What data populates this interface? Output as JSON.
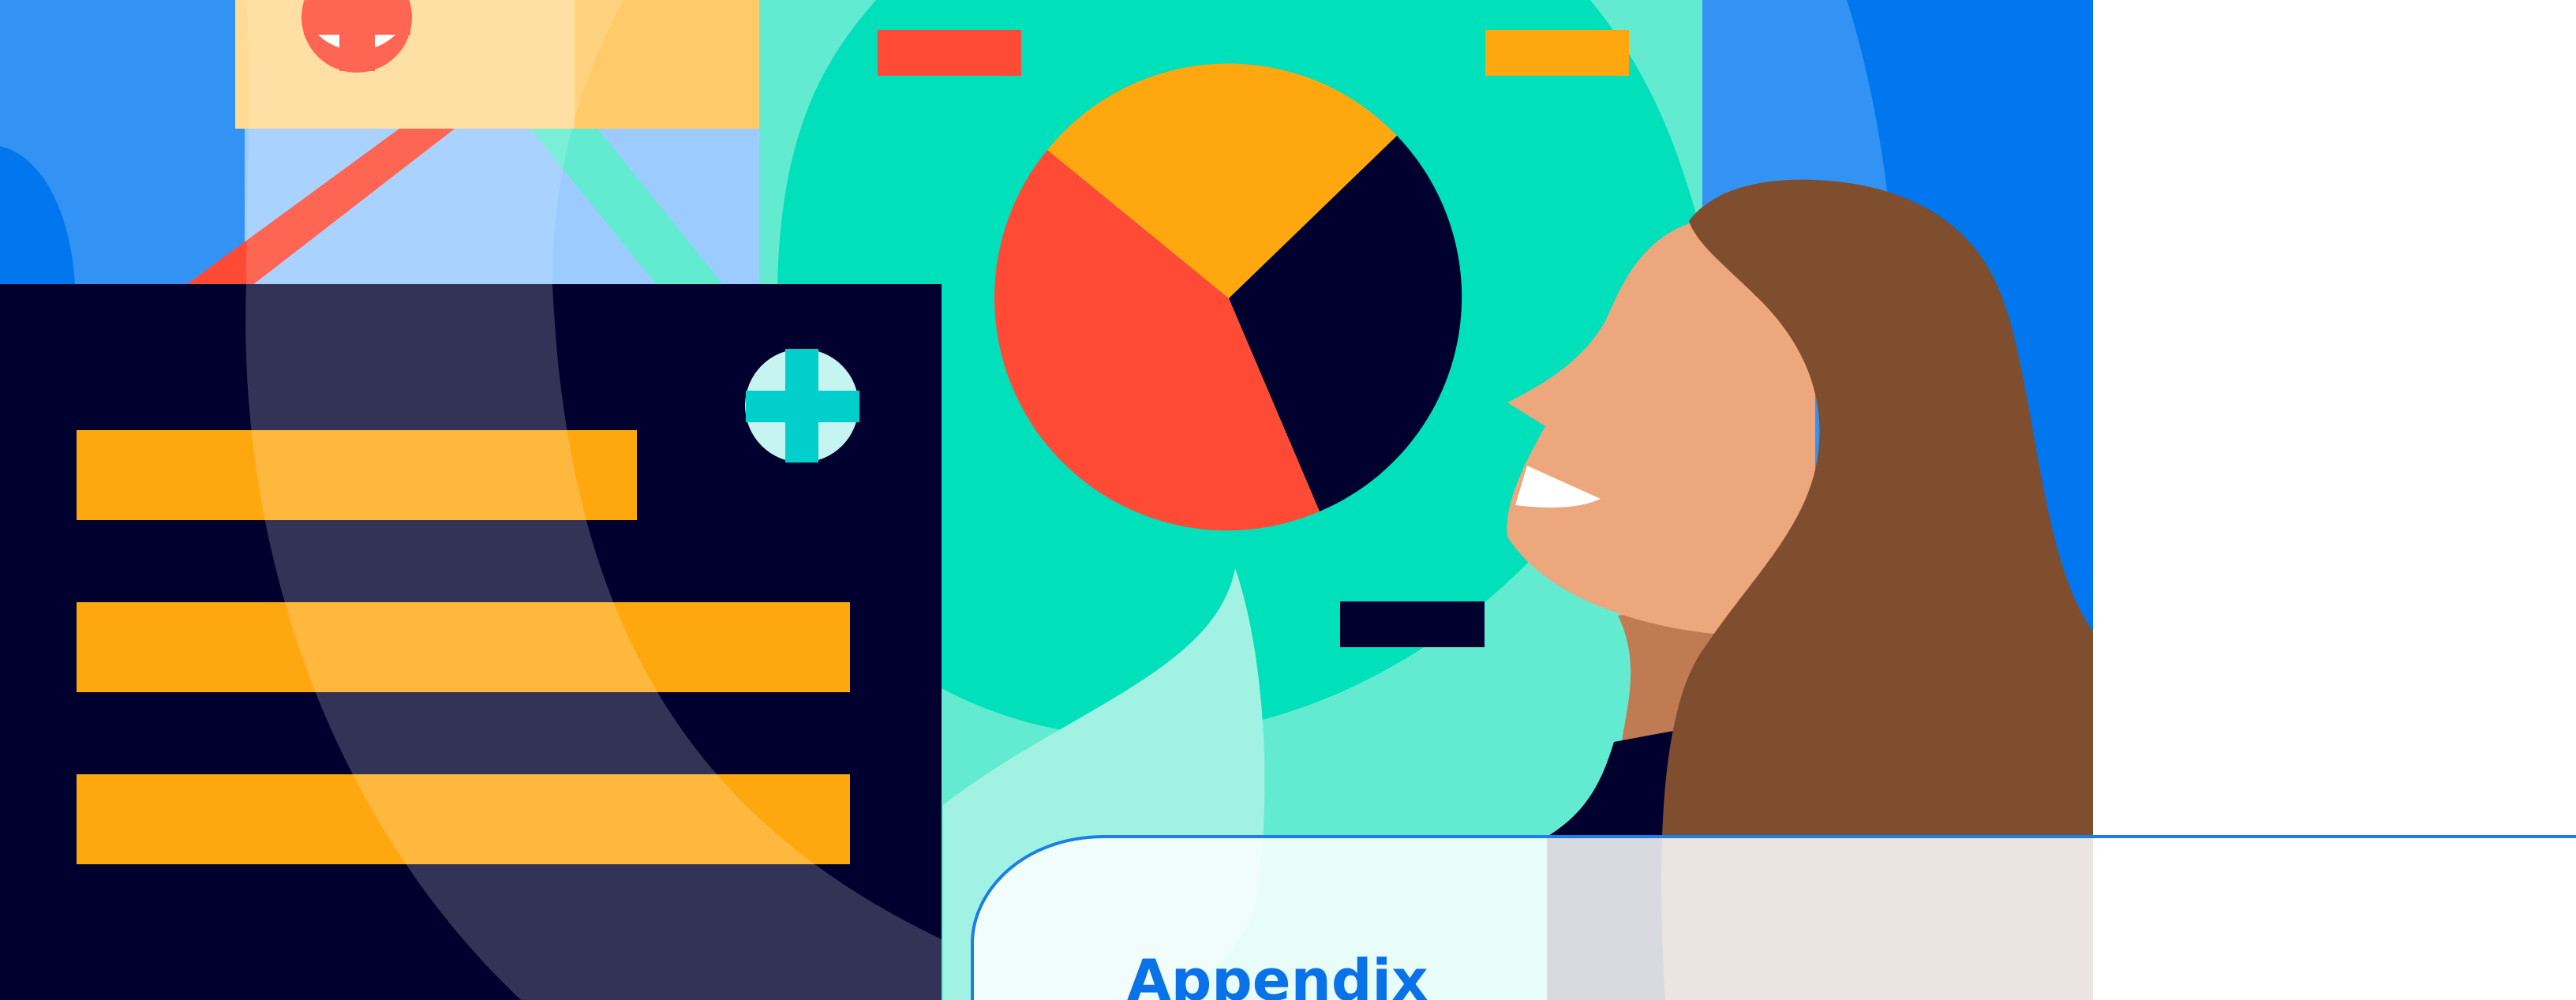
{
  "section_tab": {
    "title": "Appendix"
  },
  "illustration": {
    "subject": "woman-with-medical-chart-illustration",
    "icons": [
      "medical-cross-icon",
      "medical-cross-icon",
      "pie-chart-icon"
    ]
  },
  "colors": {
    "background_blue": "#3393F5",
    "deep_blue": "#0077EE",
    "navy": "#00002F",
    "teal": "#00E0BA",
    "light_teal": "#63EBD1",
    "orange": "#FFA70E",
    "red_orange": "#FF4B35",
    "skin": "#EDA77D",
    "hair": "#7F4E2F",
    "accent_line": "#1A7FE6",
    "title_text": "#0A72E8",
    "white": "#FFFFFF"
  }
}
